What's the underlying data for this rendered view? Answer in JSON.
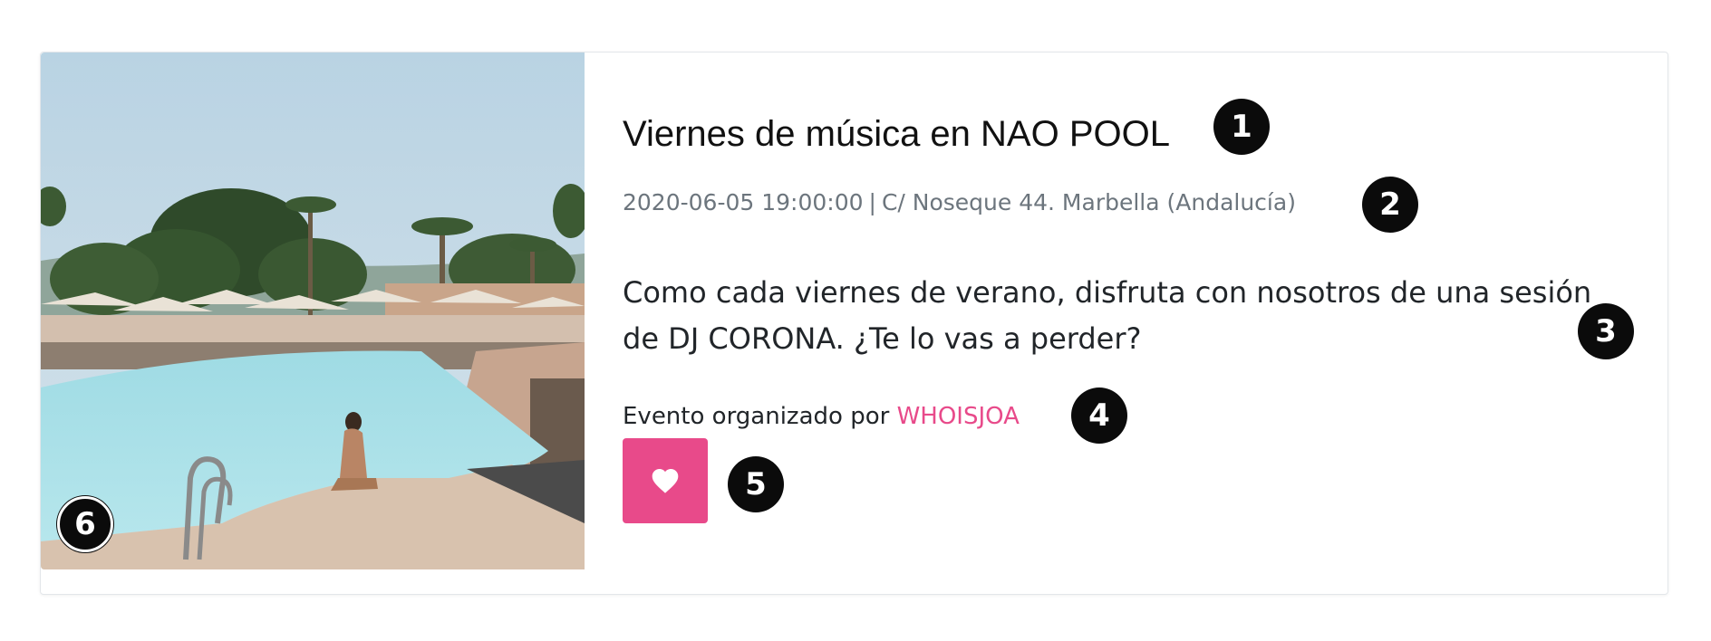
{
  "event": {
    "title": "Viernes de música en NAO POOL",
    "date": "2020-06-05 19:00:00",
    "separator": "|",
    "address": "C/ Noseque 44. Marbella (Andalucía)",
    "description": "Como cada viernes de verano, disfruta con nosotros de una sesión de DJ CORONA. ¿Te lo vas a perder?",
    "organizer_prefix": "Evento organizado por",
    "organizer_name": "WHOISJOA",
    "like_icon": "heart-icon",
    "image_subject": "pool-photo"
  },
  "annotations": [
    "1",
    "2",
    "3",
    "4",
    "5",
    "6"
  ],
  "colors": {
    "accent": "#e84a8a",
    "meta_text": "#6c757d",
    "badge": "#0b0b0b"
  }
}
